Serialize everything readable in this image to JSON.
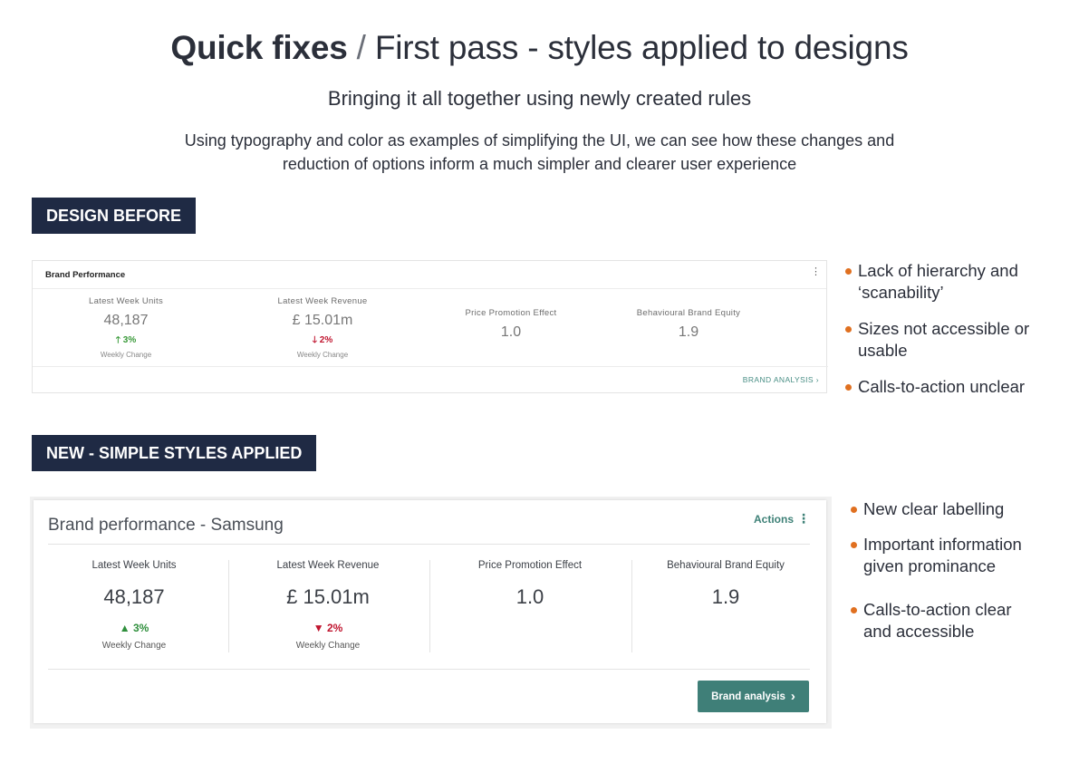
{
  "header": {
    "title_bold": "Quick fixes",
    "title_sep": " / ",
    "title_rest": "First pass - styles applied to designs",
    "subtitle": "Bringing it all together using newly created rules",
    "desc_line1": "Using typography and color as examples of simplifying the UI, we can see how these changes and",
    "desc_line2": "reduction of options inform a much simpler and clearer user experience"
  },
  "sections": {
    "before_label": "DESIGN BEFORE",
    "new_label": "NEW - SIMPLE STYLES APPLIED"
  },
  "old_card": {
    "title": "Brand Performance",
    "menu_icon": "vertical-dots-icon",
    "metrics": [
      {
        "label": "Latest Week Units",
        "value": "48,187",
        "change": "3%",
        "direction": "up",
        "sub": "Weekly Change"
      },
      {
        "label": "Latest Week Revenue",
        "value": "£ 15.01m",
        "change": "2%",
        "direction": "down",
        "sub": "Weekly Change"
      },
      {
        "label": "Price Promotion Effect",
        "value": "1.0"
      },
      {
        "label": "Behavioural Brand Equity",
        "value": "1.9"
      }
    ],
    "link": "BRAND ANALYSIS"
  },
  "new_card": {
    "title": "Brand performance - Samsung",
    "actions_label": "Actions",
    "metrics": [
      {
        "label": "Latest Week Units",
        "value": "48,187",
        "change": "3%",
        "direction": "up",
        "sub": "Weekly Change"
      },
      {
        "label": "Latest Week Revenue",
        "value": "£ 15.01m",
        "change": "2%",
        "direction": "down",
        "sub": "Weekly Change"
      },
      {
        "label": "Price Promotion Effect",
        "value": "1.0"
      },
      {
        "label": "Behavioural Brand Equity",
        "value": "1.9"
      }
    ],
    "button_label": "Brand analysis"
  },
  "notes_before": [
    [
      "Lack of hierarchy and",
      "‘scanability’"
    ],
    [
      "Sizes not accessible or",
      "usable"
    ],
    [
      "Calls-to-action unclear"
    ]
  ],
  "notes_new": [
    [
      "New clear labelling"
    ],
    [
      "Important information",
      "given prominance"
    ],
    [
      "Calls-to-action clear",
      "and accessible"
    ]
  ],
  "colors": {
    "navy": "#1f2a44",
    "accent_teal": "#3f7f78",
    "positive": "#2f8f3c",
    "negative": "#c0152f",
    "bullet": "#e07020"
  }
}
